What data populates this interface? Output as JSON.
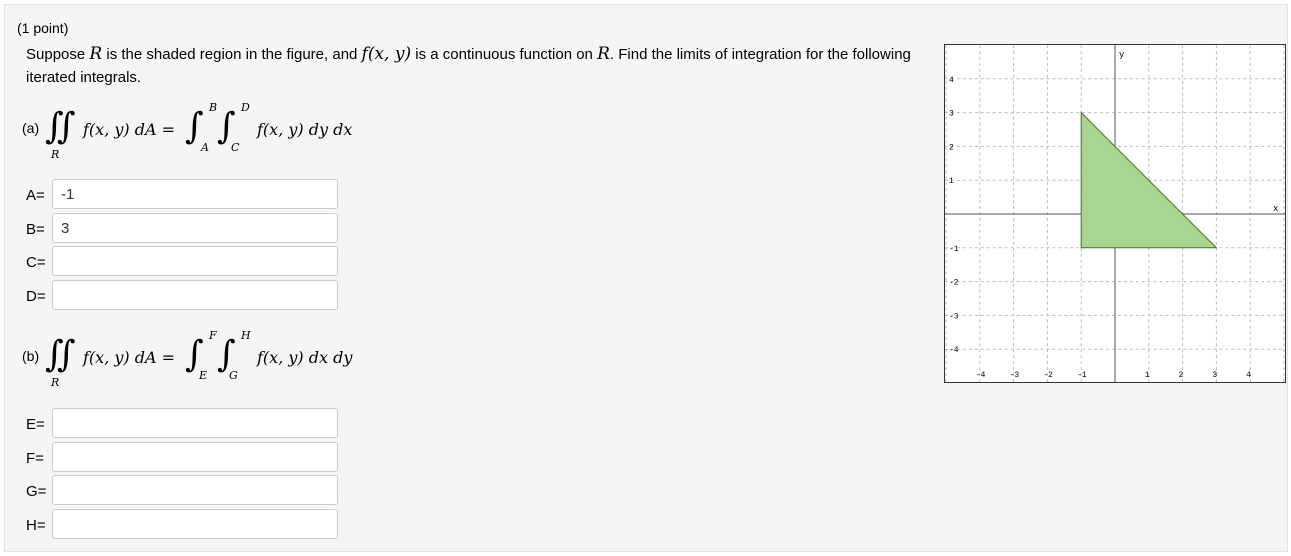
{
  "problem": {
    "points": "(1 point)",
    "prompt_before_R": "Suppose ",
    "var_R": "R",
    "prompt_mid": " is the shaded region in the figure, and ",
    "func": "f(x, y)",
    "prompt_after_func": " is a continuous function on ",
    "var_R2": "R",
    "prompt_end": ". Find the limits of integration for the following iterated integrals."
  },
  "part_a": {
    "label": "(a)",
    "region": "R",
    "lhs": "f(x, y) dA =",
    "upper_outer": "B",
    "lower_outer": "A",
    "upper_inner": "D",
    "lower_inner": "C",
    "rhs": "f(x, y) dy dx",
    "fields": [
      {
        "label": "A=",
        "value": "-1"
      },
      {
        "label": "B=",
        "value": "3"
      },
      {
        "label": "C=",
        "value": ""
      },
      {
        "label": "D=",
        "value": ""
      }
    ]
  },
  "part_b": {
    "label": "(b)",
    "region": "R",
    "lhs": "f(x, y) dA =",
    "upper_outer": "F",
    "lower_outer": "E",
    "upper_inner": "H",
    "lower_inner": "G",
    "rhs": "f(x, y) dx dy",
    "fields": [
      {
        "label": "E=",
        "value": ""
      },
      {
        "label": "F=",
        "value": ""
      },
      {
        "label": "G=",
        "value": ""
      },
      {
        "label": "H=",
        "value": ""
      }
    ]
  },
  "graph": {
    "x_label": "x",
    "y_label": "y",
    "x_ticks": [
      "-4",
      "-3",
      "-2",
      "-1",
      "1",
      "2",
      "3",
      "4"
    ],
    "y_ticks": [
      "4",
      "3",
      "2",
      "1",
      "-1",
      "-2",
      "-3",
      "-4"
    ],
    "region_vertices": [
      [
        -1,
        -1
      ],
      [
        -1,
        3
      ],
      [
        3,
        -1
      ]
    ],
    "fill_color": "#a8d58f",
    "stroke_color": "#3d7a2a"
  }
}
